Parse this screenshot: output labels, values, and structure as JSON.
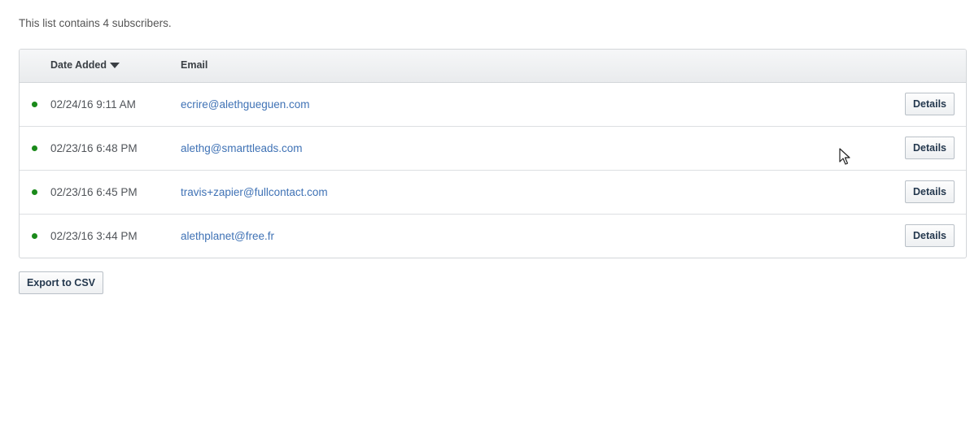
{
  "summary": "This list contains 4 subscribers.",
  "table": {
    "columns": {
      "date_added": "Date Added",
      "email": "Email"
    },
    "sort_icon": "caret-down-icon",
    "rows": [
      {
        "date": "02/24/16 9:11 AM",
        "email": "ecrire@alethgueguen.com",
        "status": "active",
        "action": "Details"
      },
      {
        "date": "02/23/16 6:48 PM",
        "email": "alethg@smarttleads.com",
        "status": "active",
        "action": "Details"
      },
      {
        "date": "02/23/16 6:45 PM",
        "email": "travis+zapier@fullcontact.com",
        "status": "active",
        "action": "Details"
      },
      {
        "date": "02/23/16 3:44 PM",
        "email": "alethplanet@free.fr",
        "status": "active",
        "action": "Details"
      }
    ]
  },
  "export_label": "Export to CSV",
  "colors": {
    "status_active": "#1a8a1a",
    "link": "#3f72b5",
    "button_text": "#24384e"
  }
}
